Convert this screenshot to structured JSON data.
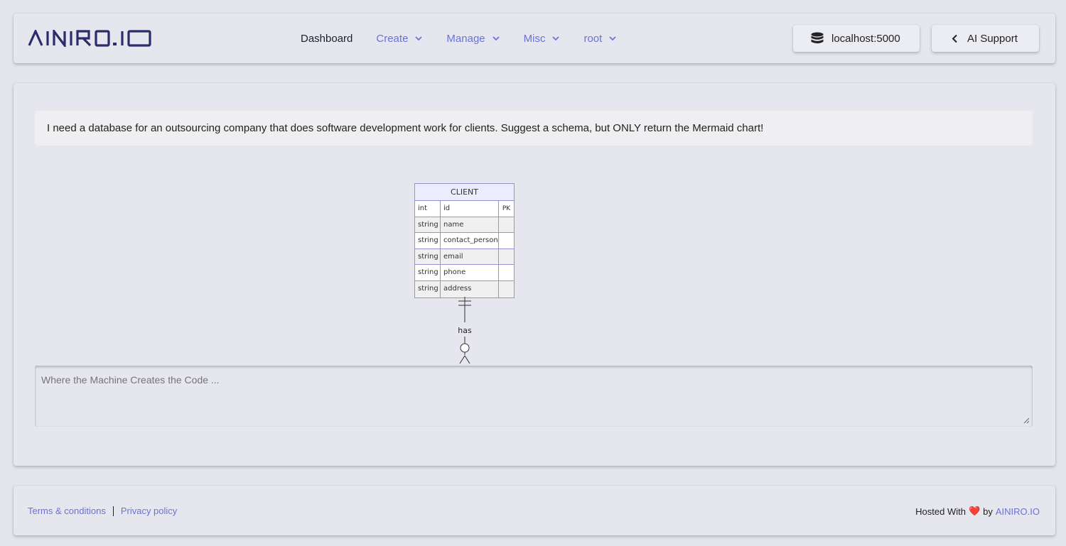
{
  "header": {
    "logo_text": "AINIRO.IO",
    "nav": [
      {
        "label": "Dashboard",
        "has_dropdown": false
      },
      {
        "label": "Create",
        "has_dropdown": true
      },
      {
        "label": "Manage",
        "has_dropdown": true
      },
      {
        "label": "Misc",
        "has_dropdown": true
      },
      {
        "label": "root",
        "has_dropdown": true
      }
    ],
    "database_button": {
      "label": "localhost:5000",
      "icon": "database-icon"
    },
    "support_button": {
      "label": "AI Support",
      "icon": "chevron-left-icon"
    }
  },
  "chat": {
    "prompt": "I need a database for an outsourcing company that does software development work for clients. Suggest a schema, but ONLY return the Mermaid chart!",
    "diagram": {
      "entity": "CLIENT",
      "columns": [
        {
          "type": "int",
          "name": "id",
          "key": "PK"
        },
        {
          "type": "string",
          "name": "name",
          "key": ""
        },
        {
          "type": "string",
          "name": "contact_person",
          "key": ""
        },
        {
          "type": "string",
          "name": "email",
          "key": ""
        },
        {
          "type": "string",
          "name": "phone",
          "key": ""
        },
        {
          "type": "string",
          "name": "address",
          "key": ""
        }
      ],
      "relationship_label": "has"
    },
    "input_placeholder": "Where the Machine Creates the Code ..."
  },
  "footer": {
    "terms": "Terms & conditions",
    "privacy": "Privacy policy",
    "hosted_text": "Hosted With",
    "heart": "❤️",
    "by_text": "by",
    "brand_link": "AINIRO.IO"
  },
  "colors": {
    "accent": "#6b72d6",
    "background": "#e4e4ed",
    "entity_fill": "#ececff",
    "entity_border": "#9a91d4"
  }
}
